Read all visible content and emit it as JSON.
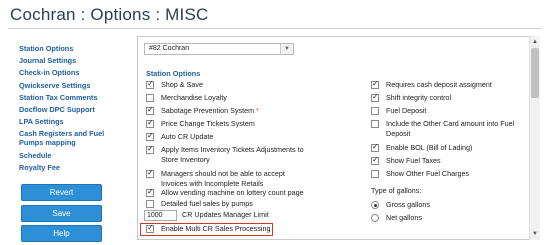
{
  "page": {
    "title": "Cochran : Options : MISC"
  },
  "sidebar": {
    "items": [
      {
        "label": "Station Options"
      },
      {
        "label": "Journal Settings"
      },
      {
        "label": "Check-in Options"
      },
      {
        "label": "Qwickserve Settings"
      },
      {
        "label": "Station Tax Comments"
      },
      {
        "label": "Docflow DPC Support"
      },
      {
        "label": "LPA Settings"
      },
      {
        "label": "Cash Registers and Fuel"
      },
      {
        "label": "Pumps mapping"
      },
      {
        "label": "Schedule"
      },
      {
        "label": "Royalty Fee"
      }
    ],
    "buttons": {
      "revert": "Revert",
      "save": "Save",
      "help": "Help"
    }
  },
  "station": {
    "selected": "#82   Cochran"
  },
  "options": {
    "section_title": "Station Options",
    "left": [
      {
        "label": "Shop & Save",
        "checked": true
      },
      {
        "label": "Merchandise Loyalty",
        "checked": false
      },
      {
        "label": "Sabotage Prevention System",
        "checked": true,
        "required_mark": "*"
      },
      {
        "label": "Price Change Tickets System",
        "checked": true
      },
      {
        "label": "Auto CR Update",
        "checked": true
      },
      {
        "label": "Apply Items Inventory Tickets Adjustments to",
        "label2": "Store Inventory",
        "checked": true
      },
      {
        "label": "Managers should not be able to accept",
        "label2": "Invoices with Incomplete Retails",
        "checked": true
      },
      {
        "label": "Allow vending machine on lottery count page",
        "checked": true
      },
      {
        "label": "Detailed fuel sales by pumps",
        "checked": false
      }
    ],
    "limit": {
      "value": "1000",
      "label": "CR Updates Manager Limit"
    },
    "multi_cr": {
      "label": "Enable Multi CR Sales Processing",
      "checked": true
    },
    "right": [
      {
        "label": "Requires cash deposit assigment",
        "checked": true
      },
      {
        "label": "Shift integrity control",
        "checked": true
      },
      {
        "label": "Fuel Deposit",
        "checked": false
      },
      {
        "label": "Include the Other Card amount into Fuel",
        "label2": "Deposit",
        "checked": false
      },
      {
        "label": "Enable BOL (Bill of Lading)",
        "checked": true
      },
      {
        "label": "Show Fuel Taxes",
        "checked": true
      },
      {
        "label": "Show Other Fuel Charges",
        "checked": false
      }
    ],
    "gallons": {
      "label": "Type of gallons:",
      "options": [
        {
          "label": "Gross gallons",
          "selected": true
        },
        {
          "label": "Net gallons",
          "selected": false
        }
      ]
    }
  }
}
